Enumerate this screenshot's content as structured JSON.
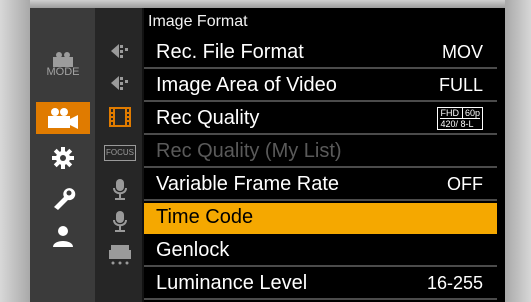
{
  "page_title": "Image Format",
  "main_tabs": [
    {
      "name": "mode-tab",
      "label": "MODE"
    },
    {
      "name": "video-tab",
      "active": true
    },
    {
      "name": "gear-tab"
    },
    {
      "name": "wrench-tab"
    },
    {
      "name": "person-tab"
    }
  ],
  "sub_tabs": [
    "arrow-page-1",
    "arrow-page-2",
    "film-page",
    "focus-page",
    "mic-page-1",
    "mic-page-2",
    "flash-page"
  ],
  "focus_label": "FOCUS",
  "menu": [
    {
      "label": "Rec. File Format",
      "value": "MOV"
    },
    {
      "label": "Image Area of Video",
      "value": "FULL"
    },
    {
      "label": "Rec Quality",
      "badge": {
        "line1a": "FHD",
        "line1b": "60p",
        "line2": "420/ 8-L"
      }
    },
    {
      "label": "Rec Quality (My List)",
      "value": "",
      "disabled": true
    },
    {
      "label": "Variable Frame Rate",
      "value": "OFF"
    },
    {
      "label": "Time Code",
      "value": "",
      "selected": true
    },
    {
      "label": "Genlock",
      "value": ""
    },
    {
      "label": "Luminance Level",
      "value": "16-255"
    }
  ],
  "colors": {
    "accent_orange": "#e07b00",
    "highlight_yellow": "#f5a800"
  }
}
